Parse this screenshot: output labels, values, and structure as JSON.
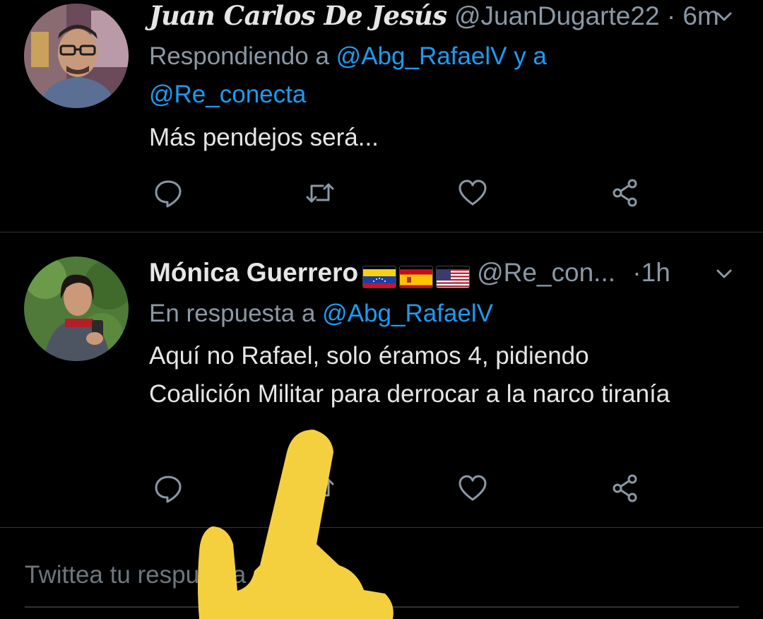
{
  "tweets": [
    {
      "display_name": "Juan Carlos De Jesús",
      "handle": "@JuanDugarte22",
      "separator": "·",
      "time": "6m",
      "reply_prefix": "Respondiendo a",
      "reply_mention_1": "@Abg_RafaelV",
      "reply_joiner": "y a",
      "reply_mention_2": "@Re_conecta",
      "text": "Más pendejos será..."
    },
    {
      "display_name": "Mónica Guerrero",
      "flags": [
        "venezuela-flag",
        "spain-flag",
        "usa-flag"
      ],
      "handle": "@Re_con...",
      "separator": "·",
      "time": "1h",
      "reply_prefix": "En respuesta a",
      "reply_mention_1": "@Abg_RafaelV",
      "text": "Aquí no Rafael, solo éramos 4, pidiendo Coalición Militar para derrocar a la narco tiranía"
    }
  ],
  "actions": [
    "reply-icon",
    "retweet-icon",
    "like-icon",
    "share-icon"
  ],
  "compose": {
    "placeholder": "Twittea tu respuesta"
  },
  "colors": {
    "background": "#000000",
    "accent": "#1d9bf0",
    "muted": "#8b98a5",
    "text": "#e6e6e6",
    "divider": "#2f3336",
    "overlay_pointer": "#f4d03f"
  }
}
